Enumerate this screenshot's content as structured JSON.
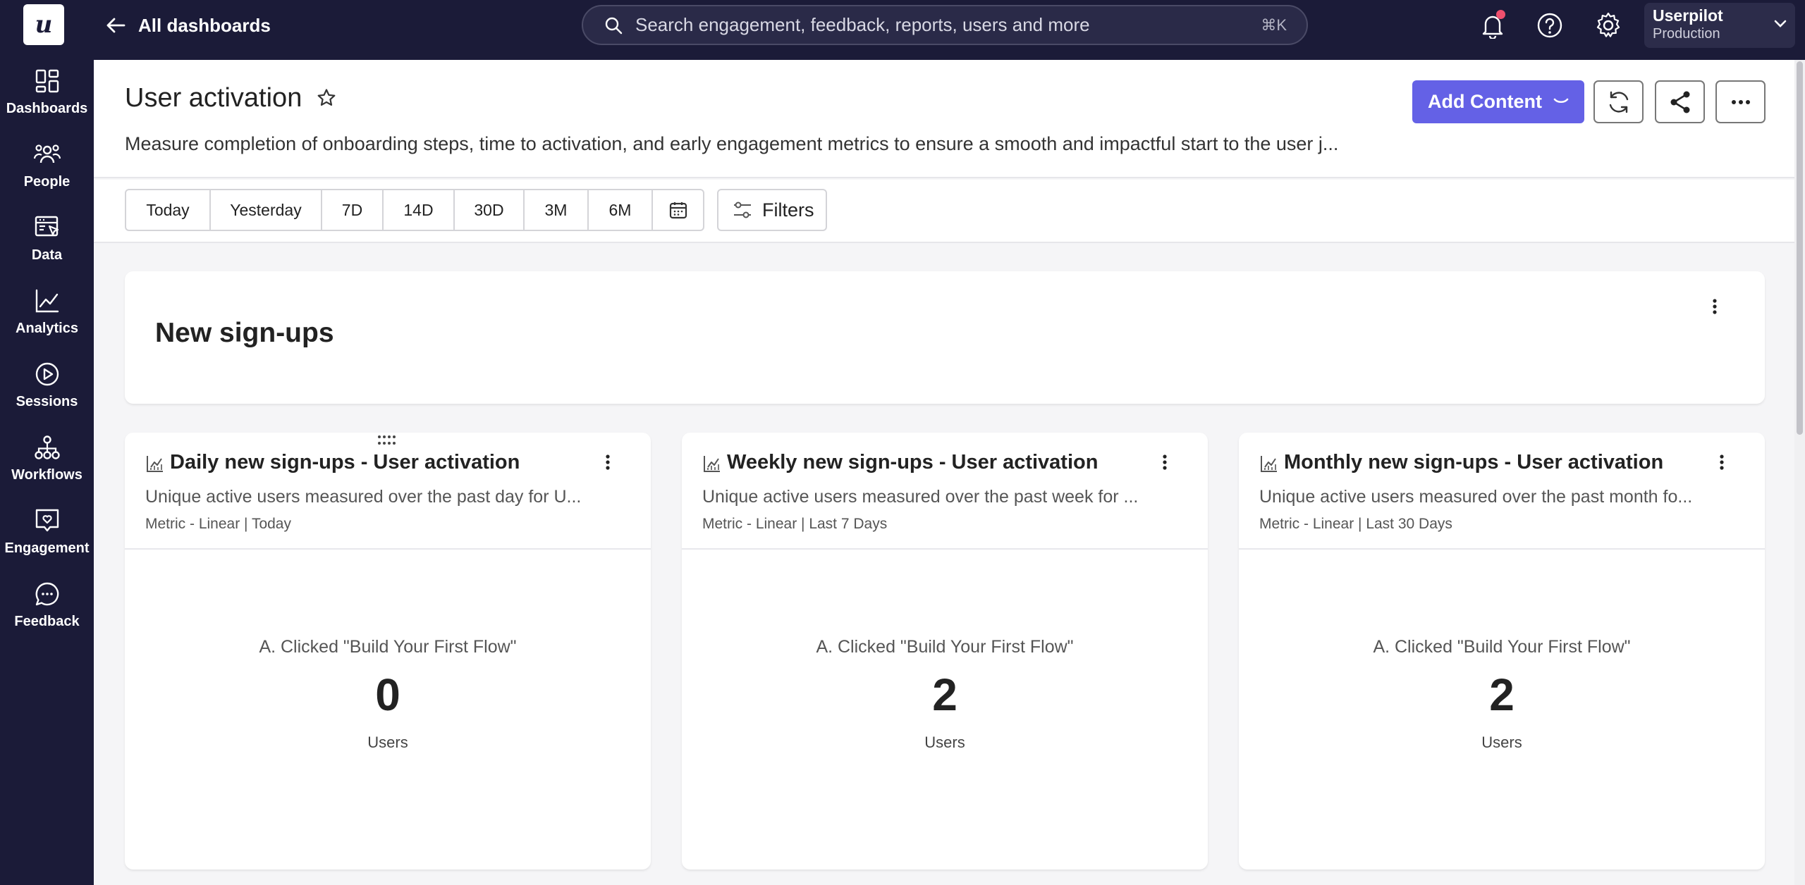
{
  "topbar": {
    "logo_letter": "u",
    "back_label": "All dashboards",
    "search_placeholder": "Search engagement, feedback, reports, users and more",
    "search_shortcut": "⌘K",
    "account_name": "Userpilot",
    "account_env": "Production",
    "icons": [
      "bell-icon",
      "help-icon",
      "gear-icon",
      "chevron-down-icon"
    ]
  },
  "sidebar": {
    "items": [
      {
        "label": "Dashboards",
        "icon": "dashboards-icon"
      },
      {
        "label": "People",
        "icon": "people-icon"
      },
      {
        "label": "Data",
        "icon": "data-icon"
      },
      {
        "label": "Analytics",
        "icon": "analytics-icon"
      },
      {
        "label": "Sessions",
        "icon": "sessions-icon"
      },
      {
        "label": "Workflows",
        "icon": "workflows-icon"
      },
      {
        "label": "Engagement",
        "icon": "engagement-icon"
      },
      {
        "label": "Feedback",
        "icon": "feedback-icon"
      }
    ]
  },
  "header": {
    "title": "User activation",
    "description": "Measure completion of onboarding steps, time to activation, and early engagement metrics to ensure a smooth and impactful start to the user j...",
    "add_content_label": "Add Content"
  },
  "toolbar": {
    "ranges": [
      "Today",
      "Yesterday",
      "7D",
      "14D",
      "30D",
      "3M",
      "6M"
    ],
    "filters_label": "Filters"
  },
  "section": {
    "title": "New sign-ups"
  },
  "cards": [
    {
      "title": "Daily new sign-ups - User activation",
      "description": "Unique active users measured over the past day for U...",
      "meta": "Metric - Linear | Today",
      "event": "A. Clicked \"Build Your First Flow\"",
      "value": "0",
      "unit": "Users"
    },
    {
      "title": "Weekly new sign-ups - User activation",
      "description": "Unique active users measured over the past week for ...",
      "meta": "Metric - Linear | Last 7 Days",
      "event": "A. Clicked \"Build Your First Flow\"",
      "value": "2",
      "unit": "Users"
    },
    {
      "title": "Monthly new sign-ups - User activation",
      "description": "Unique active users measured over the past month fo...",
      "meta": "Metric - Linear | Last 30 Days",
      "event": "A. Clicked \"Build Your First Flow\"",
      "value": "2",
      "unit": "Users"
    }
  ],
  "colors": {
    "nav_bg": "#1b1b38",
    "accent": "#6461e6",
    "notification": "#f0506e"
  }
}
